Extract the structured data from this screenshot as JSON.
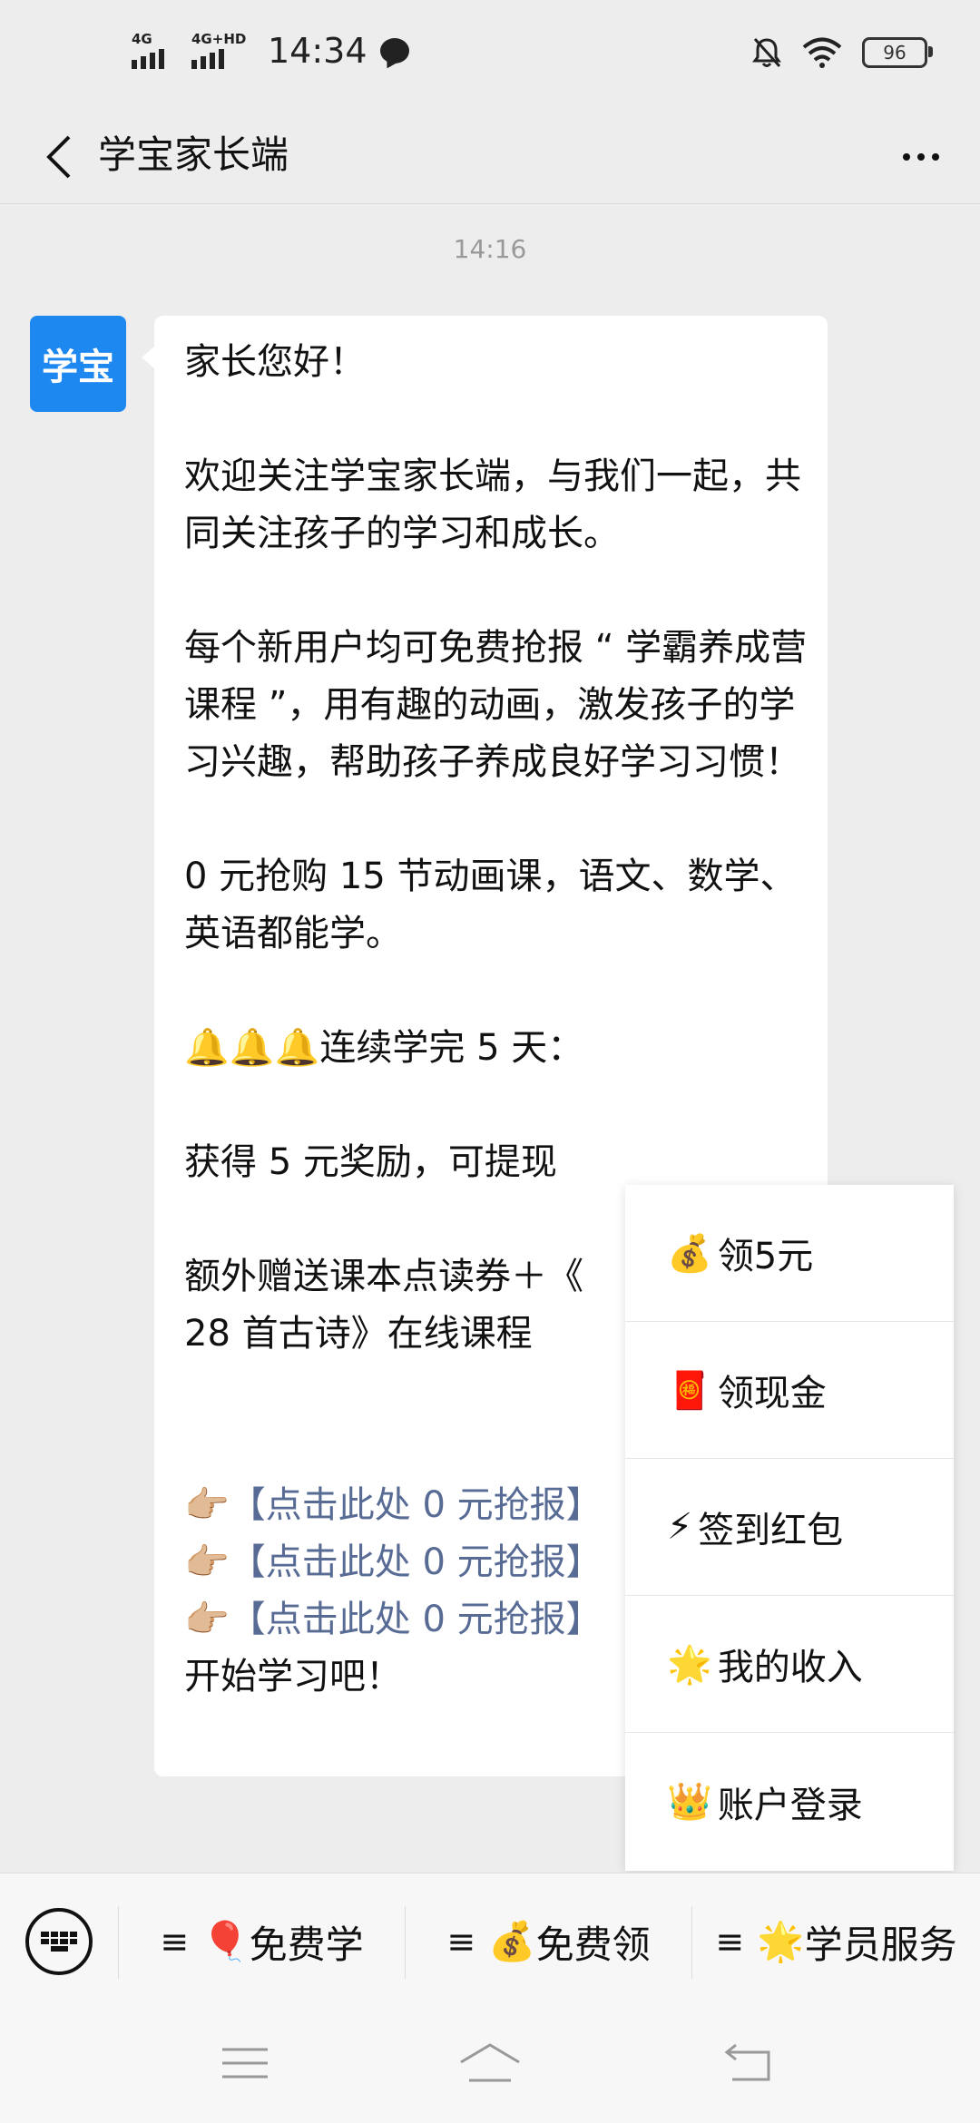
{
  "status_bar": {
    "network_1": "4G",
    "network_2": "4G+HD",
    "time": "14:34",
    "battery": "96"
  },
  "header": {
    "title": "学宝家长端"
  },
  "chat": {
    "timestamp": "14:16",
    "avatar_text": "学宝",
    "lines": [
      "家长您好！",
      "欢迎关注学宝家长端，与我们一起，共同关注孩子的学习和成长。",
      "每个新用户均可免费抢报 “ 学霸养成营课程 ”，用有趣的动画，激发孩子的学习兴趣，帮助孩子养成良好学习习惯！",
      "0 元抢购 15 节动画课，语文、数学、英语都能学。",
      "🔔🔔🔔连续学完 5 天：",
      "获得 5 元奖励，可提现",
      "额外赠送课本点读券＋《",
      "28 首古诗》在线课程",
      "👉🏼【点击此处 0 元抢报】",
      "👉🏼【点击此处 0 元抢报】",
      "👉🏼【点击此处 0 元抢报】",
      "开始学习吧！"
    ]
  },
  "popup_menu": {
    "items": [
      {
        "emoji": "💰",
        "label": "领5元"
      },
      {
        "emoji": "🧧",
        "label": "领现金"
      },
      {
        "emoji": "⚡",
        "label": "签到红包"
      },
      {
        "emoji": "🌟",
        "label": "我的收入"
      },
      {
        "emoji": "👑",
        "label": "账户登录"
      }
    ]
  },
  "menu_bar": {
    "hamburger": "≡",
    "items": [
      {
        "emoji": "🎈",
        "label": "免费学"
      },
      {
        "emoji": "💰",
        "label": "免费领"
      },
      {
        "emoji": "🌟",
        "label": "学员服务"
      }
    ]
  }
}
